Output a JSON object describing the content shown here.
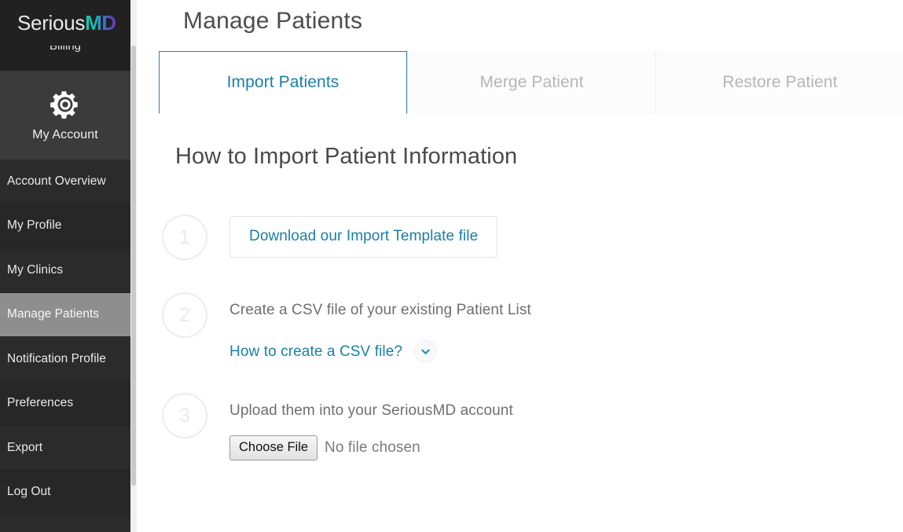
{
  "brand": {
    "name_part1": "Serious",
    "name_part2": "MD",
    "accent_teal": "#1fc8a6",
    "accent_purple": "#6a35b8"
  },
  "sidebar": {
    "clipped_item_label": "Billing",
    "account_section": {
      "icon": "gear-icon",
      "label": "My Account"
    },
    "items": [
      {
        "label": "Account Overview",
        "active": false
      },
      {
        "label": "My Profile",
        "active": false
      },
      {
        "label": "My Clinics",
        "active": false
      },
      {
        "label": "Manage Patients",
        "active": true
      },
      {
        "label": "Notification Profile",
        "active": false
      },
      {
        "label": "Preferences",
        "active": false
      },
      {
        "label": "Export",
        "active": false
      },
      {
        "label": "Log Out",
        "active": false
      }
    ]
  },
  "main": {
    "page_title": "Manage Patients",
    "tabs": [
      {
        "label": "Import Patients",
        "active": true
      },
      {
        "label": "Merge Patient",
        "active": false
      },
      {
        "label": "Restore Patient",
        "active": false
      }
    ],
    "section_title": "How to Import Patient Information",
    "steps": [
      {
        "number": "1",
        "button_label": "Download our Import Template file"
      },
      {
        "number": "2",
        "text": "Create a CSV file of your existing Patient List",
        "link_label": "How to create a CSV file?",
        "expand_icon": "chevron-down-icon"
      },
      {
        "number": "3",
        "text": "Upload them into your SeriousMD account",
        "file_button_label": "Choose File",
        "file_status": "No file chosen"
      }
    ]
  },
  "colors": {
    "accent_link": "#1a7fa8",
    "tab_border": "#2e7ea8",
    "sidebar_bg": "#2b2b2b",
    "sidebar_active_bg": "#8e8e8e"
  }
}
